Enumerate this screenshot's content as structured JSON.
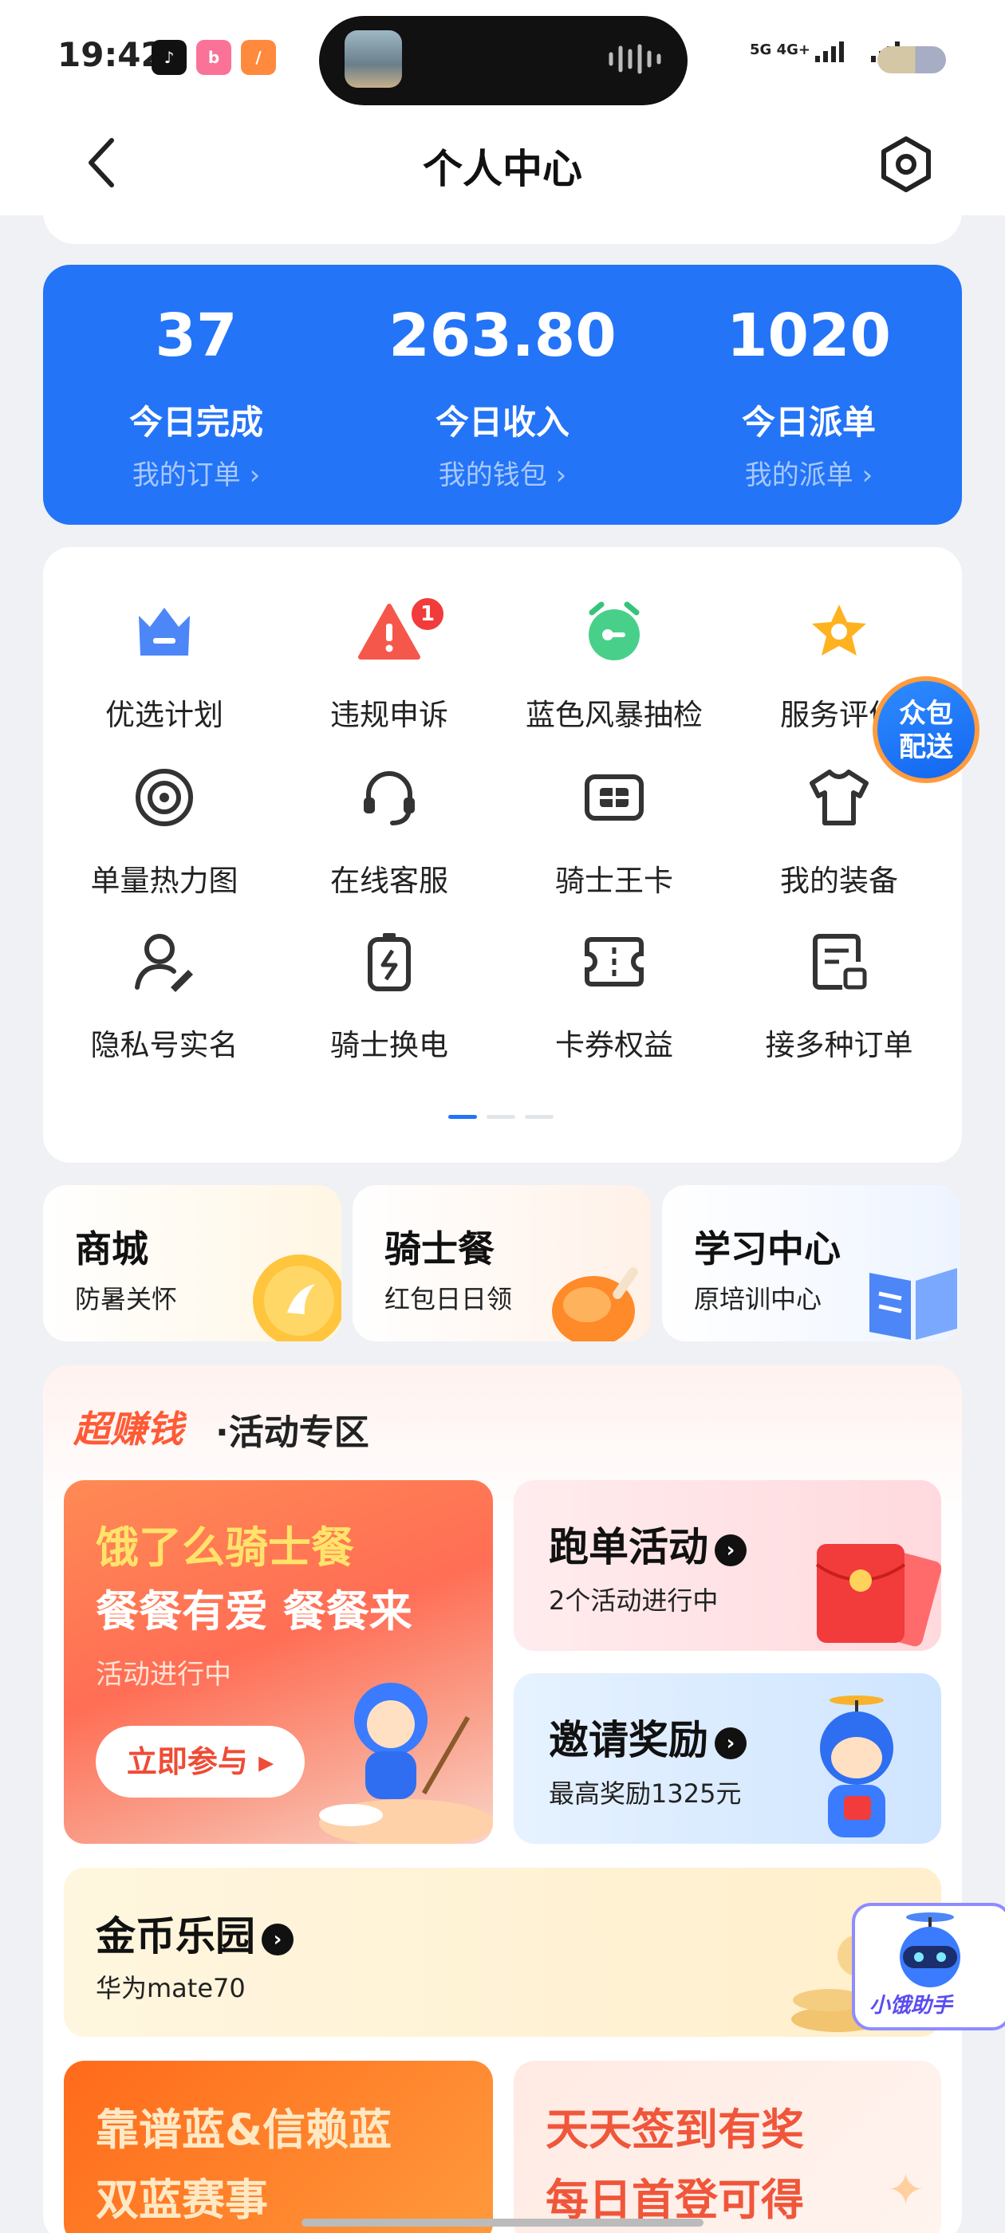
{
  "status_bar": {
    "time": "19:42",
    "apps": [
      {
        "icon": "music-app-icon",
        "color": "#111111"
      },
      {
        "icon": "bilibili-app-icon",
        "color": "#fb7299"
      },
      {
        "icon": "slash-app-icon",
        "color": "#ff8a3d"
      }
    ],
    "network": "5G 4G+",
    "battery_colors": [
      "#d4c7a6",
      "#a7adc4"
    ]
  },
  "nav": {
    "title": "个人中心",
    "back_icon": "chevron-left-icon",
    "settings_icon": "hexagon-settings-icon"
  },
  "stats": [
    {
      "value": "37",
      "label": "今日完成",
      "link": "我的订单 ›"
    },
    {
      "value": "263.80",
      "label": "今日收入",
      "link": "我的钱包 ›"
    },
    {
      "value": "1020",
      "label": "今日派单",
      "link": "我的派单 ›"
    }
  ],
  "grid": [
    {
      "label": "优选计划",
      "icon": "crown-icon",
      "badge": ""
    },
    {
      "label": "违规申诉",
      "icon": "warning-icon",
      "badge": "1"
    },
    {
      "label": "蓝色风暴抽检",
      "icon": "alarm-key-icon",
      "badge": ""
    },
    {
      "label": "服务评价",
      "icon": "star-badge-icon",
      "badge": ""
    },
    {
      "label": "单量热力图",
      "icon": "target-icon",
      "badge": ""
    },
    {
      "label": "在线客服",
      "icon": "headset-icon",
      "badge": ""
    },
    {
      "label": "骑士王卡",
      "icon": "sim-card-icon",
      "badge": ""
    },
    {
      "label": "我的装备",
      "icon": "shirt-icon",
      "badge": ""
    },
    {
      "label": "隐私号实名",
      "icon": "user-privacy-icon",
      "badge": ""
    },
    {
      "label": "骑士换电",
      "icon": "battery-swap-icon",
      "badge": ""
    },
    {
      "label": "卡券权益",
      "icon": "coupon-icon",
      "badge": ""
    },
    {
      "label": "接多种订单",
      "icon": "order-doc-icon",
      "badge": ""
    }
  ],
  "crowd_delivery": {
    "line1": "众包",
    "line2": "配送"
  },
  "quick_cards": [
    {
      "title": "商城",
      "subtitle": "防暑关怀",
      "icon": "gold-coin-icon"
    },
    {
      "title": "骑士餐",
      "subtitle": "红包日日领",
      "icon": "chicken-leg-icon"
    },
    {
      "title": "学习中心",
      "subtitle": "原培训中心",
      "icon": "book-icon"
    }
  ],
  "activity": {
    "hot_label": "超赚钱",
    "zone_label": "·活动专区",
    "banner_main": {
      "line1": "饿了么骑士餐",
      "line2": "餐餐有爱 餐餐来",
      "status": "活动进行中",
      "button": "立即参与"
    },
    "run_orders": {
      "title": "跑单活动",
      "subtitle": "2个活动进行中"
    },
    "invite": {
      "title": "邀请奖励",
      "subtitle": "最高奖励1325元"
    },
    "coin_park": {
      "title": "金币乐园",
      "subtitle": "华为mate70"
    },
    "blue_race": {
      "line1": "靠谱蓝&信赖蓝",
      "line2": "双蓝赛事"
    },
    "checkin": {
      "line1": "天天签到有奖",
      "line2": "每日首登可得"
    }
  },
  "helper": {
    "label": "小饿助手"
  }
}
